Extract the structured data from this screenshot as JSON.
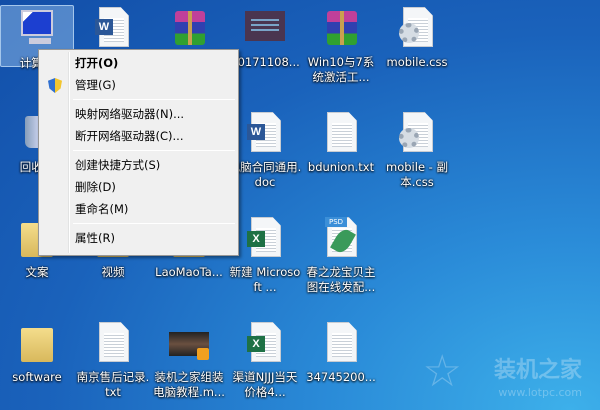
{
  "icons": [
    {
      "label": "计算机",
      "type": "computer"
    },
    {
      "label": "",
      "type": "word"
    },
    {
      "label": "",
      "type": "rar"
    },
    {
      "label": "20171108...",
      "type": "image"
    },
    {
      "label": "Win10与7系统激活工...",
      "type": "rar"
    },
    {
      "label": "mobile.css",
      "type": "css"
    },
    {
      "label": "回收站",
      "type": "recycle"
    },
    {
      "label": "电脑合同通用.doc",
      "type": "word"
    },
    {
      "label": "bdunion.txt",
      "type": "txt"
    },
    {
      "label": "mobile - 副本.css",
      "type": "css"
    },
    {
      "label": "文案",
      "type": "folder"
    },
    {
      "label": "视频",
      "type": "folder"
    },
    {
      "label": "LaoMaoTa...",
      "type": "folder"
    },
    {
      "label": "新建 Microsoft ...",
      "type": "excel"
    },
    {
      "label": "春之龙宝贝主图在线发配...",
      "type": "psd"
    },
    {
      "label": "software",
      "type": "folder"
    },
    {
      "label": "南京售后记录.txt",
      "type": "txt"
    },
    {
      "label": "装机之家组装电脑教程.m...",
      "type": "video"
    },
    {
      "label": "渠道NJJJ当天价格4...",
      "type": "excel"
    },
    {
      "label": "34745200...",
      "type": "txt"
    }
  ],
  "menu": {
    "open": "打开(O)",
    "manage": "管理(G)",
    "map_drive": "映射网络驱动器(N)...",
    "disconnect_drive": "断开网络驱动器(C)...",
    "create_shortcut": "创建快捷方式(S)",
    "delete": "删除(D)",
    "rename": "重命名(M)",
    "properties": "属性(R)"
  },
  "watermark": {
    "brand": "装机之家",
    "url": "www.lotpc.com"
  }
}
